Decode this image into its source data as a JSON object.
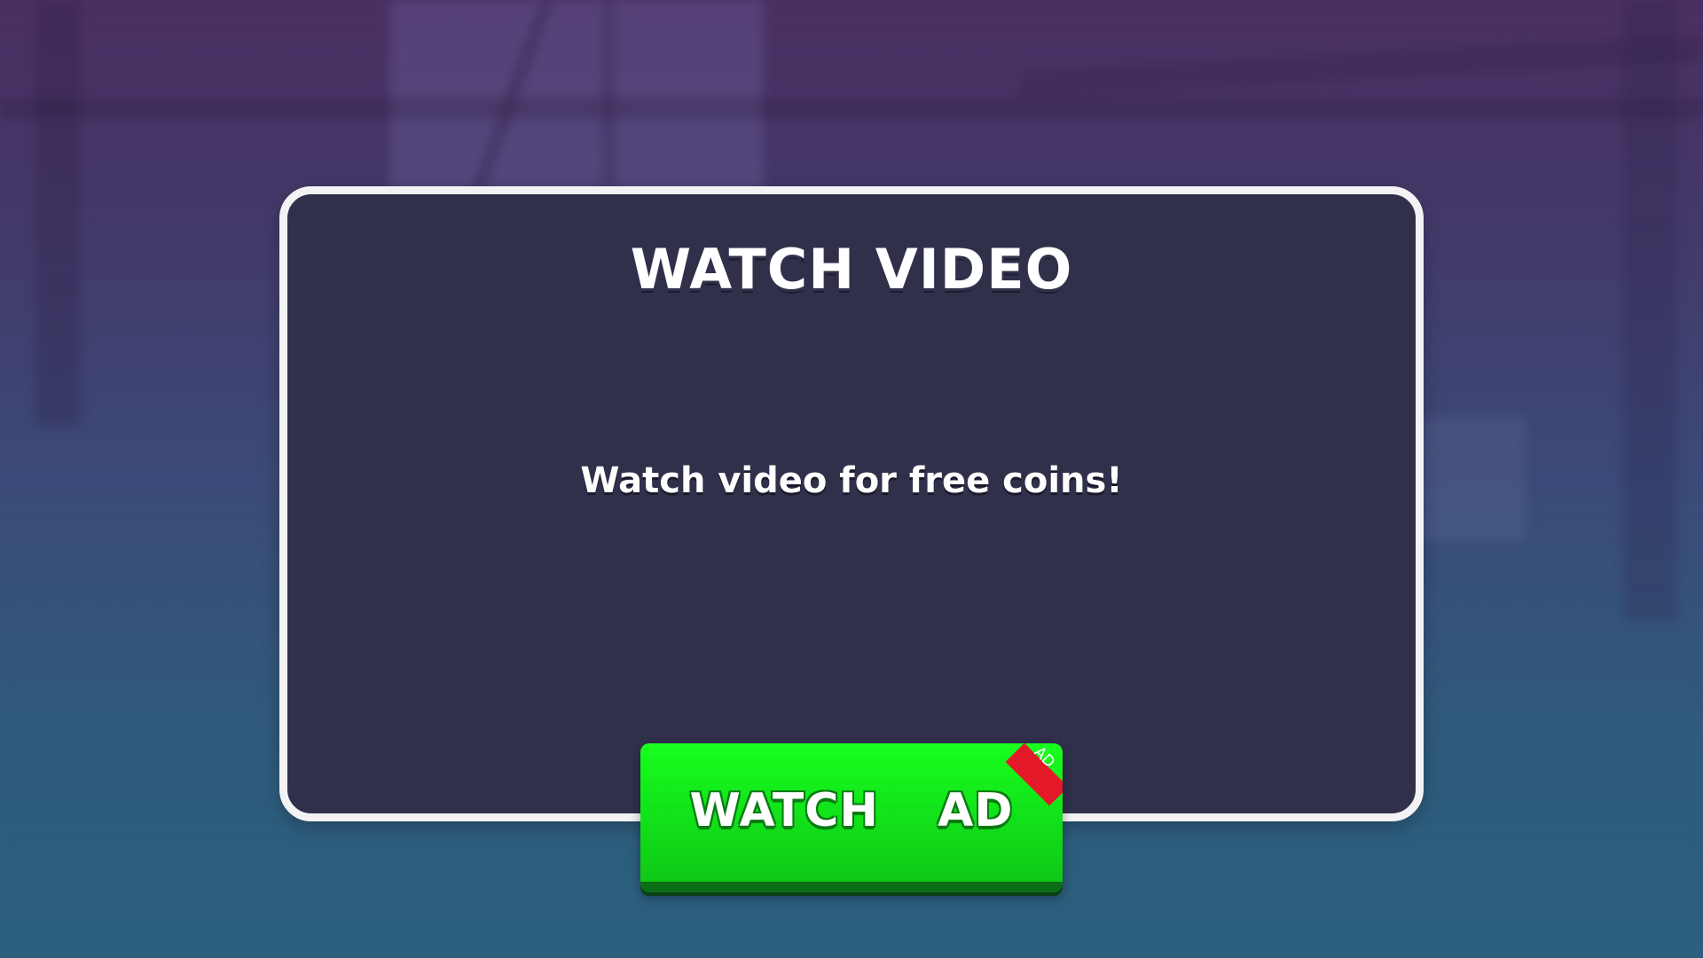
{
  "dialog": {
    "title": "WATCH VIDEO",
    "message": "Watch video for free coins!"
  },
  "watch_ad_button": {
    "label": "WATCH  AD",
    "badge": "AD"
  },
  "colors": {
    "panel_background": "#30304b",
    "panel_border": "#f3f3f6",
    "button_green": "#12e61a",
    "button_green_dark": "#0b6e17",
    "ad_badge_red": "#e3192a"
  }
}
